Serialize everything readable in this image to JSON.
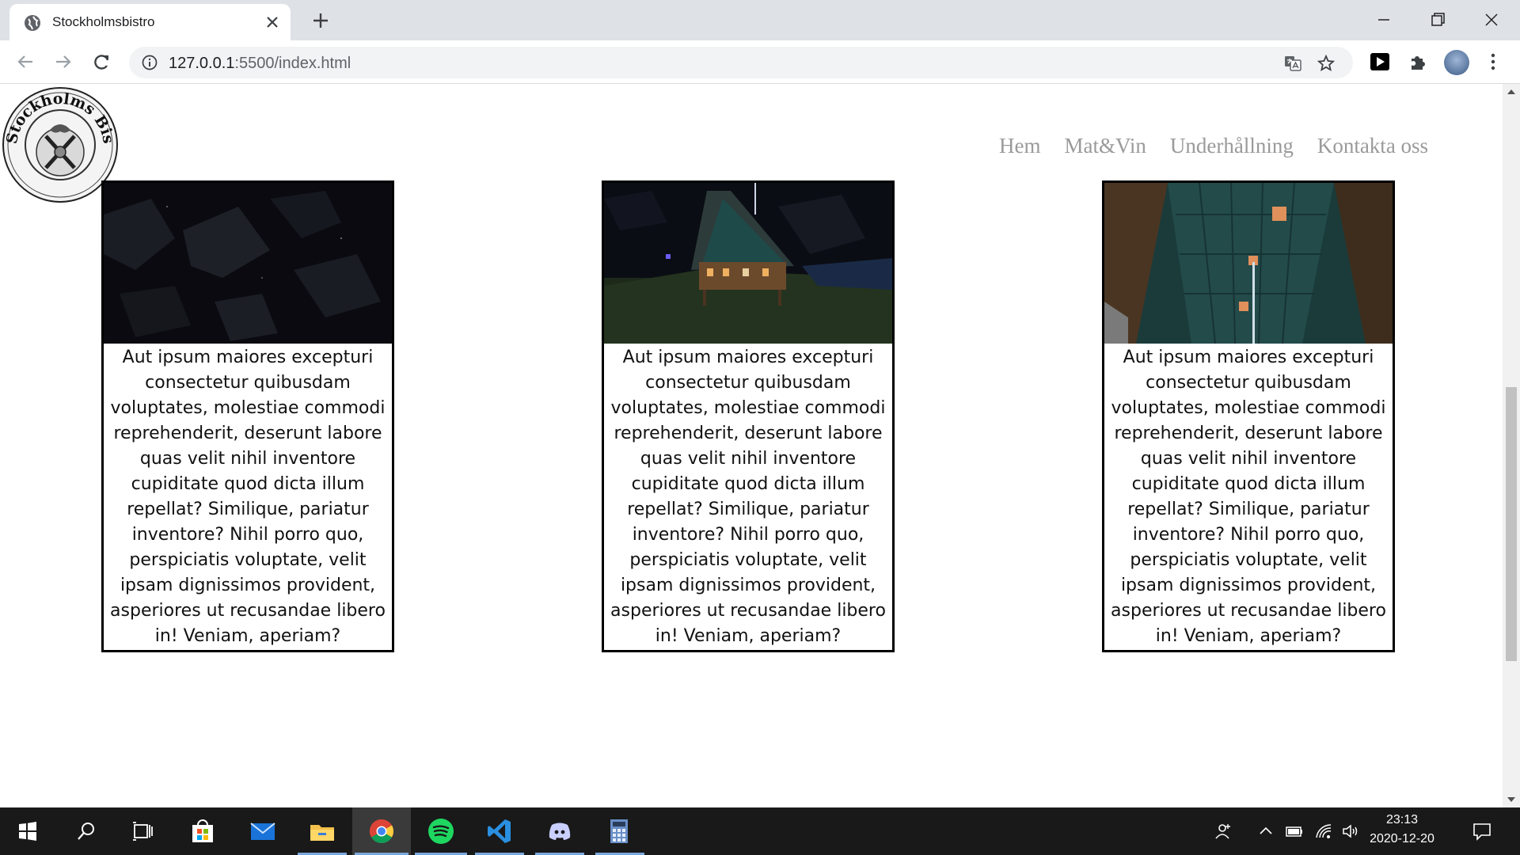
{
  "browser": {
    "tab_title": "Stockholmsbistro",
    "url_host": "127.0.0.1",
    "url_rest": ":5500/index.html"
  },
  "site": {
    "logo_alt": "Stockholms Bistro",
    "nav": [
      "Hem",
      "Mat&Vin",
      "Underhållning",
      "Kontakta oss"
    ]
  },
  "cards": [
    {
      "image": "night-sky-scene",
      "text": "Aut ipsum maiores excepturi consectetur quibusdam voluptates, molestiae commodi reprehenderit, deserunt labore quas velit nihil inventore cupiditate quod dicta illum repellat? Similique, pariatur inventore? Nihil porro quo, perspiciatis voluptate, velit ipsam dignissimos provident, asperiores ut recusandae libero in! Veniam, aperiam?"
    },
    {
      "image": "house-at-night-scene",
      "text": "Aut ipsum maiores excepturi consectetur quibusdam voluptates, molestiae commodi reprehenderit, deserunt labore quas velit nihil inventore cupiditate quod dicta illum repellat? Similique, pariatur inventore? Nihil porro quo, perspiciatis voluptate, velit ipsam dignissimos provident, asperiores ut recusandae libero in! Veniam, aperiam?"
    },
    {
      "image": "ceiling-lanterns-scene",
      "text": "Aut ipsum maiores excepturi consectetur quibusdam voluptates, molestiae commodi reprehenderit, deserunt labore quas velit nihil inventore cupiditate quod dicta illum repellat? Similique, pariatur inventore? Nihil porro quo, perspiciatis voluptate, velit ipsam dignissimos provident, asperiores ut recusandae libero in! Veniam, aperiam?"
    }
  ],
  "taskbar": {
    "apps": [
      "windows-start-icon",
      "search-icon",
      "task-view-icon",
      "store-icon",
      "mail-icon",
      "file-explorer-icon",
      "chrome-icon",
      "spotify-icon",
      "vscode-icon",
      "discord-icon",
      "calculator-icon"
    ],
    "time": "23:13",
    "date": "2020-12-20"
  }
}
